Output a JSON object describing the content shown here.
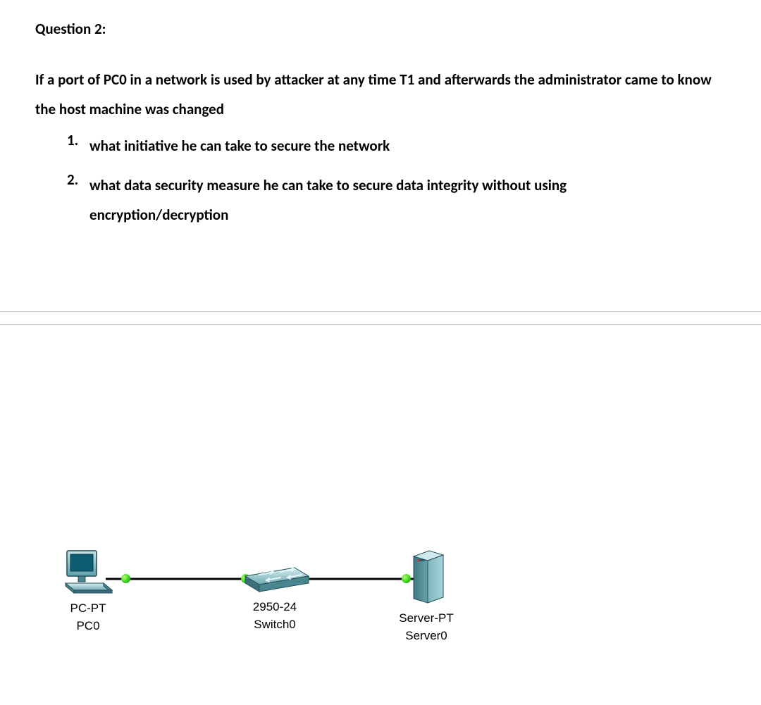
{
  "question": {
    "title": "Question 2:",
    "paragraph": "If a port of PC0 in a network is used by attacker at any time T1 and  afterwards the administrator came to know the host machine was changed",
    "items": [
      {
        "num": "1.",
        "text": "what initiative he can take to secure the network"
      },
      {
        "num": "2.",
        "text": "what data security measure he can take to secure data integrity  without using encryption/decryption"
      }
    ]
  },
  "diagram": {
    "devices": {
      "pc": {
        "type": "PC-PT",
        "name": "PC0",
        "icon": "pc-icon"
      },
      "switch": {
        "model": "2950-24",
        "name": "Switch0",
        "icon": "switch-icon"
      },
      "server": {
        "type": "Server-PT",
        "name": "Server0",
        "icon": "server-icon"
      }
    },
    "links": [
      {
        "from": "pc",
        "to": "switch",
        "status_a": "up",
        "status_b": "up"
      },
      {
        "from": "switch",
        "to": "server",
        "status_a": "up",
        "status_b": "up"
      }
    ],
    "link_color": "#000000",
    "status_color_up": "#2ecc1a"
  }
}
